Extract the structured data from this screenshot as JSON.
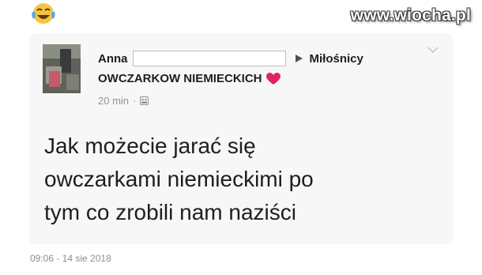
{
  "emoji": "joy-emoji",
  "watermark": "www.wiocha.pl",
  "post": {
    "author": "Anna",
    "group_line1": "Miłośnicy",
    "group_line2": "OWCZARKOW NIEMIECKICH",
    "time": "20 min",
    "separator": "·",
    "privacy_icon": "group-icon",
    "text_lines": [
      "Jak możecie jarać się",
      "owczarkami niemieckimi po",
      "tym co zrobili nam naziści"
    ]
  },
  "footer": {
    "timestamp": "09:06 - 14 sie 2018"
  },
  "colors": {
    "heart": "#e0245e",
    "card_bg": "#f7f7f8",
    "text": "#1c1e21",
    "meta": "#90949c"
  }
}
